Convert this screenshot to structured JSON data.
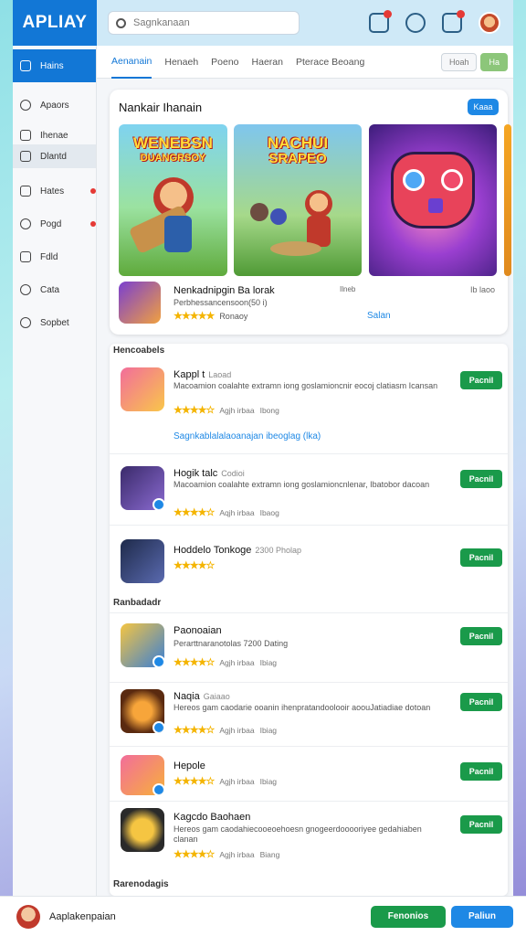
{
  "app": {
    "logo": "APLIAY"
  },
  "header": {
    "search_placeholder": "Sagnkanaan",
    "icons": [
      "mail-icon",
      "help-icon",
      "cart-icon",
      "avatar"
    ]
  },
  "sidebar": {
    "items": [
      {
        "label": "Hains",
        "icon": "home-icon",
        "active": true
      },
      {
        "label": "Apaors",
        "icon": "apps-icon"
      },
      {
        "label": "Ihenae",
        "icon": "list-icon"
      },
      {
        "label": "Dlantd",
        "icon": "grid-icon",
        "selected": true
      },
      {
        "label": "Hates",
        "icon": "games-icon",
        "badge": true
      },
      {
        "label": "Pogd",
        "icon": "clock-icon",
        "badge": true
      },
      {
        "label": "Fdld",
        "icon": "folder-icon"
      },
      {
        "label": "Cata",
        "icon": "globe-icon"
      },
      {
        "label": "Sopbet",
        "icon": "support-icon"
      }
    ]
  },
  "tabs": {
    "items": [
      "Aenanain",
      "Henaeh",
      "Poeno",
      "Haeran",
      "Pterace Beoang"
    ],
    "tool_left": "Hoah",
    "tool_right": "Ha"
  },
  "featured": {
    "title": "Nankair Ihanain",
    "button": "Kaaa",
    "banner1_text": "WENEBSN",
    "banner1_sub": "DUANGRSOY",
    "banner2_text": "NACHUI",
    "banner2_sub": "SRAPEO",
    "game_name": "Nenkadnipgin Ba lorak",
    "game_sub": "Perbhessancensoon(50 i)",
    "stars": "★★★★★",
    "rating_text": "Ronaoy",
    "mid_text": "Ilneb",
    "right_text": "Ib laoo",
    "save": "Salan"
  },
  "list": {
    "section1": "Hencoabels",
    "section2": "Ranbadadr",
    "section3": "Rarenodagis",
    "get_label": "Pacnil",
    "rows": [
      {
        "name": "Kappl t",
        "tag": "Laoad",
        "desc": "Macoamion coalahte extramn iong goslamioncnir eocoj clatiasm Icansan",
        "stars": "★★★★☆",
        "info": "Agjh irbaa",
        "extra": "Ibong",
        "link": "Sagnkablalalaoanajan ibeoglag (lka)"
      },
      {
        "name": "Hogik talc",
        "tag": "Codioi",
        "desc": "Macoamion coalahte extramn iong goslamioncnlenar, Ibatobor dacoan",
        "stars": "★★★★☆",
        "info": "Aqjh irbaa",
        "extra": "Ibaog"
      },
      {
        "name": "Hoddelo Tonkoge",
        "tag": "2300 Pholap",
        "desc": "",
        "stars": "★★★★☆",
        "info": "",
        "extra": ""
      },
      {
        "name": "Paonoaian",
        "tag": "",
        "desc": "Perarttnaranotolas 7200 Dating",
        "stars": "★★★★☆",
        "info": "Agjh irbaa",
        "extra": "Ibiag"
      },
      {
        "name": "Naqia",
        "tag": "Gaiaao",
        "desc": "Hereos gam caodarie ooanin ihenpratandoolooir aoouJatiadiae dotoan",
        "stars": "★★★★☆",
        "info": "Agjh irbaa",
        "extra": "Ibiag"
      },
      {
        "name": "Hepole",
        "tag": "",
        "desc": "",
        "stars": "★★★★☆",
        "info": "Agjh irbaa",
        "extra": "Ibiag"
      },
      {
        "name": "Kagcdo Baohaen",
        "tag": "",
        "desc": "Hereos gam caodahiecooeoehoesn gnogeerdooooriyee gedahiaben clanan",
        "stars": "★★★★☆",
        "info": "Agjh irbaa",
        "extra": "Biang"
      }
    ]
  },
  "footer": {
    "user": "Aaplakenpaian",
    "btn_green": "Fenonios",
    "btn_blue": "Paliun"
  },
  "colors": {
    "brand": "#1277d6",
    "get": "#1a9a4a",
    "star": "#f4b400"
  }
}
